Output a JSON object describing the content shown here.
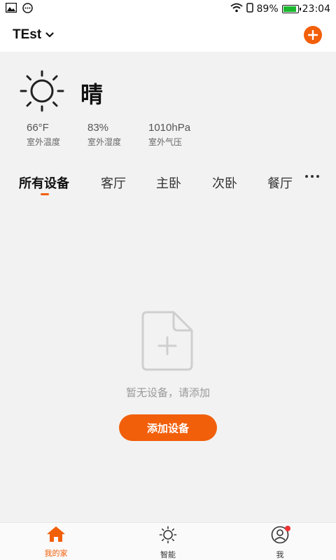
{
  "status_bar": {
    "battery_percent": "89%",
    "time": "23:04",
    "battery_level": 0.89
  },
  "header": {
    "home_name": "TEst"
  },
  "weather": {
    "condition": "晴",
    "metrics": [
      {
        "value": "66°F",
        "label": "室外温度"
      },
      {
        "value": "83%",
        "label": "室外湿度"
      },
      {
        "value": "1010hPa",
        "label": "室外气压"
      }
    ]
  },
  "tabs": [
    {
      "label": "所有设备",
      "active": true
    },
    {
      "label": "客厅"
    },
    {
      "label": "主卧"
    },
    {
      "label": "次卧"
    },
    {
      "label": "餐厅"
    }
  ],
  "empty_state": {
    "message": "暂无设备，请添加",
    "button_label": "添加设备"
  },
  "bottom_nav": [
    {
      "label": "我的家",
      "icon": "home-icon",
      "active": true
    },
    {
      "label": "智能",
      "icon": "sun-icon"
    },
    {
      "label": "我",
      "icon": "user-icon",
      "badge": true
    }
  ],
  "colors": {
    "accent": "#f25f0a",
    "background": "#f2f2f2",
    "badge": "#ee3333"
  }
}
